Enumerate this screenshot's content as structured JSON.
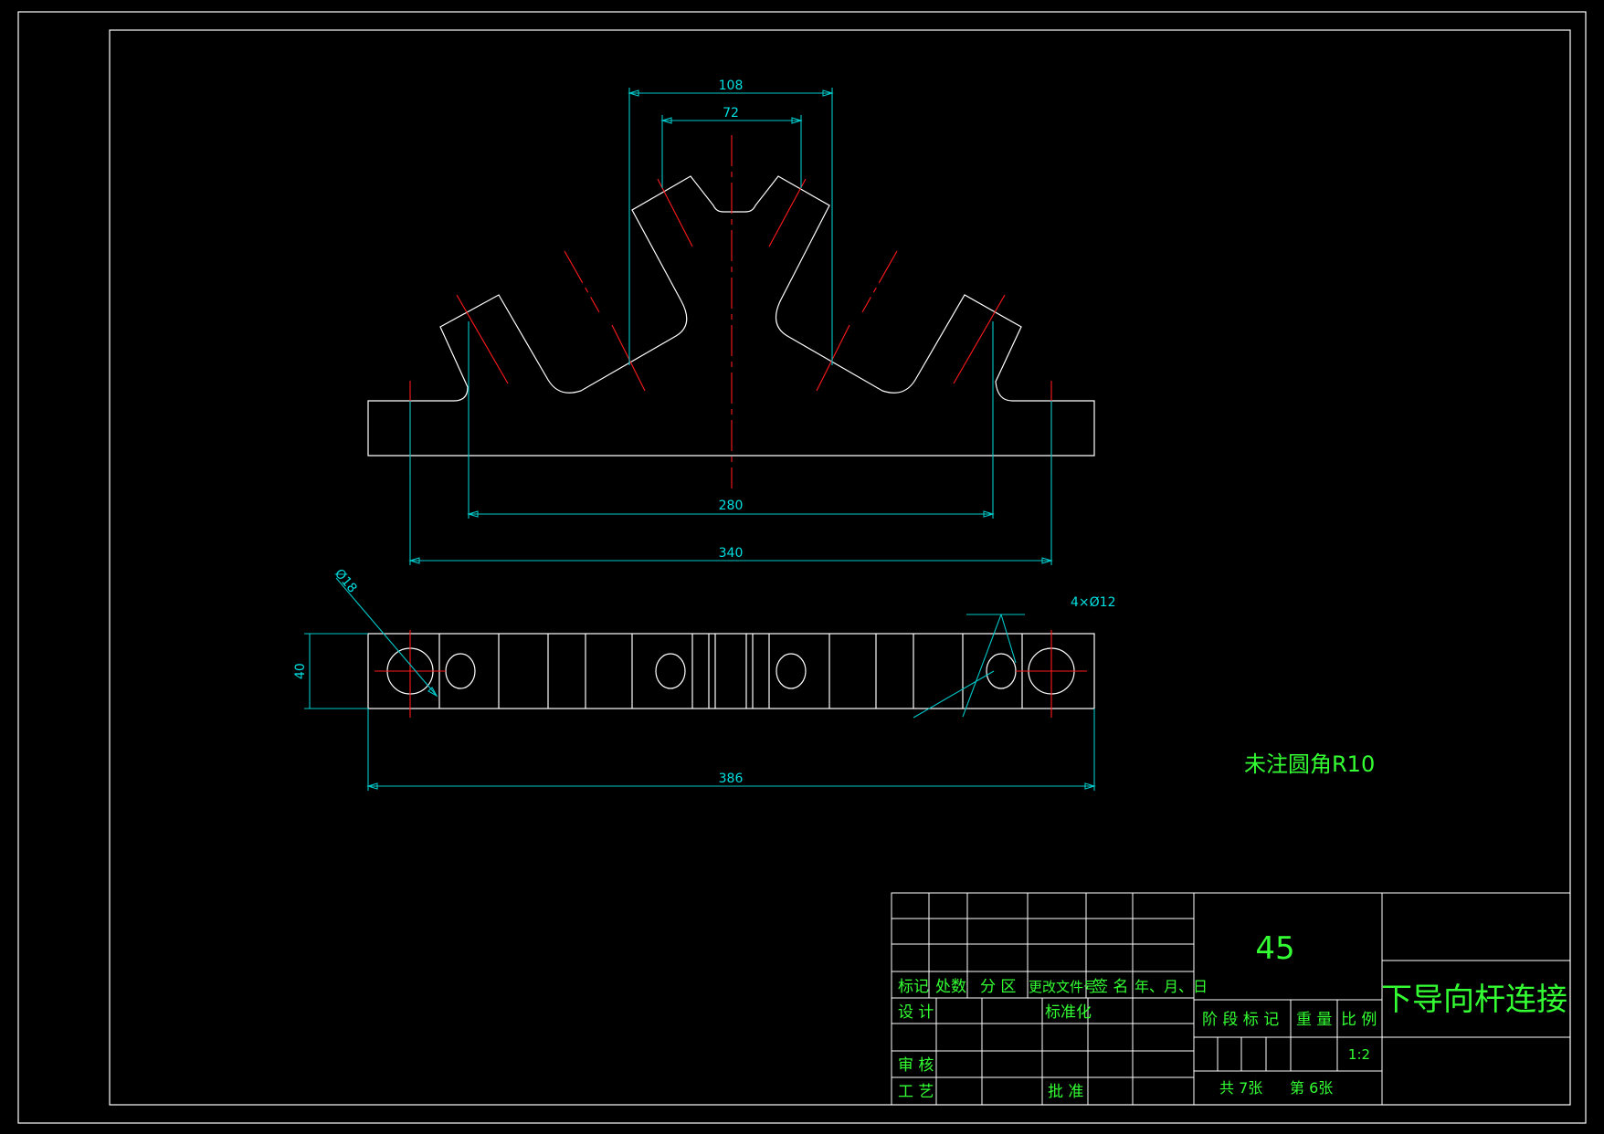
{
  "drawing": {
    "dimensions": {
      "d108": "108",
      "d72": "72",
      "d280": "280",
      "d340": "340",
      "d386": "386",
      "d40": "40",
      "dia18": "Ø18",
      "holes": "4×Ø12"
    },
    "note": "未注圆角R10"
  },
  "title_block": {
    "material": "45",
    "part_name": "下导向杆连接",
    "headers": {
      "mark": "标记",
      "count": "处数",
      "zone": "分 区",
      "change_doc": "更改文件号",
      "signature": "签 名",
      "date": "年、月、日"
    },
    "design": "设 计",
    "standardize": "标准化",
    "review": "审 核",
    "process": "工 艺",
    "approve": "批 准",
    "stage_mark": "阶 段 标 记",
    "weight": "重 量",
    "scale_label": "比 例",
    "scale_value": "1:2",
    "total_sheets": "共 7张",
    "sheet_no": "第 6张"
  },
  "colors": {
    "background": "#000000",
    "outline": "#ffffff",
    "dimension": "#00c8c8",
    "centerline": "#ff1a1a",
    "text": "#33ff33"
  }
}
